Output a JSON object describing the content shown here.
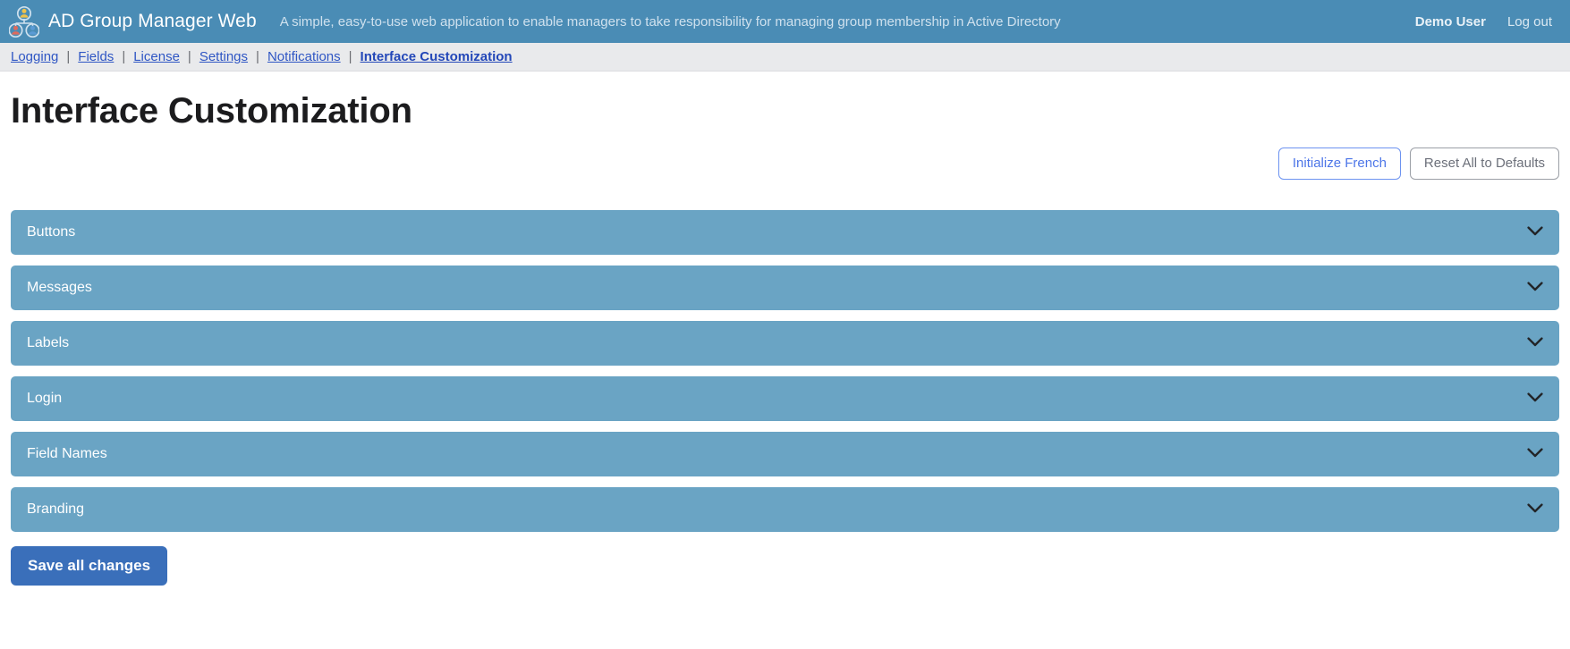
{
  "header": {
    "logo_icon": "group-hierarchy-icon",
    "brand_title": "AD Group Manager Web",
    "subtitle": "A simple, easy-to-use web application to enable managers to take responsibility for managing group membership in Active Directory",
    "user_name": "Demo User",
    "logout_label": "Log out",
    "background_color": "#4a8cb5"
  },
  "subnav": {
    "separator": "|",
    "items": [
      {
        "label": "Logging",
        "current": false
      },
      {
        "label": "Fields",
        "current": false
      },
      {
        "label": "License",
        "current": false
      },
      {
        "label": "Settings",
        "current": false
      },
      {
        "label": "Notifications",
        "current": false
      },
      {
        "label": "Interface Customization",
        "current": true
      }
    ],
    "link_color": "#2f56c4",
    "background_color": "#e9eaec"
  },
  "main": {
    "page_title": "Interface Customization",
    "actions": {
      "initialize_french_label": "Initialize French",
      "reset_all_label": "Reset All to Defaults",
      "primary_outline_color": "#4d76e8",
      "secondary_outline_color": "#6c707a"
    },
    "accordion": {
      "header_color": "#6aa4c4",
      "chevron_icon": "chevron-down-icon",
      "sections": [
        {
          "label": "Buttons",
          "expanded": false
        },
        {
          "label": "Messages",
          "expanded": false
        },
        {
          "label": "Labels",
          "expanded": false
        },
        {
          "label": "Login",
          "expanded": false
        },
        {
          "label": "Field Names",
          "expanded": false
        },
        {
          "label": "Branding",
          "expanded": false
        }
      ]
    },
    "save_button": {
      "label": "Save all changes",
      "color": "#3a6fba"
    }
  }
}
